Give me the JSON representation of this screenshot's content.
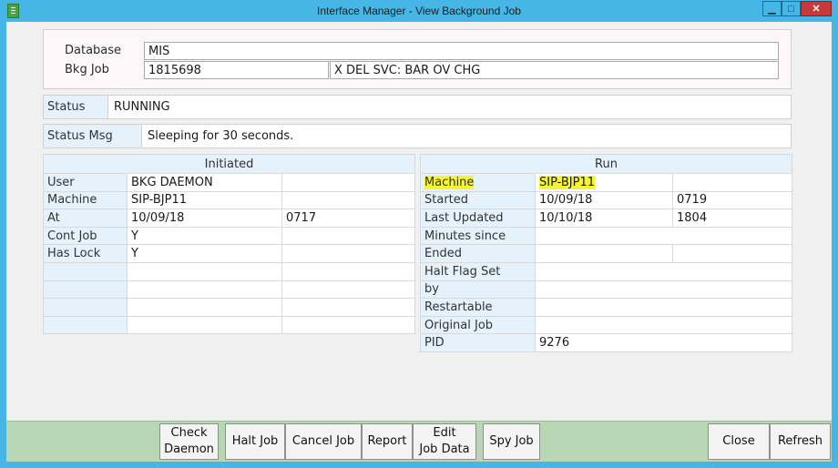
{
  "window": {
    "title": "Interface Manager - View Background Job",
    "min_label": "▁",
    "max_label": "□",
    "close_label": "✕"
  },
  "header": {
    "database_label": "Database",
    "database_value": "MIS",
    "bkg_job_label": "Bkg Job",
    "bkg_job_id": "1815698",
    "bkg_job_desc": "X DEL SVC: BAR OV CHG"
  },
  "status": {
    "label": "Status",
    "value": "RUNNING"
  },
  "status_msg": {
    "label": "Status Msg",
    "value": "Sleeping for 30 seconds."
  },
  "initiated": {
    "title": "Initiated",
    "rows": [
      {
        "label": "User",
        "value": "BKG DAEMON",
        "extra": ""
      },
      {
        "label": "Machine",
        "value": "SIP-BJP11",
        "extra": ""
      },
      {
        "label": "At",
        "value": "10/09/18",
        "extra": "0717"
      },
      {
        "label": "Cont Job",
        "value": "Y",
        "extra": ""
      },
      {
        "label": "Has Lock",
        "value": "Y",
        "extra": ""
      },
      {
        "label": "",
        "value": "",
        "extra": ""
      },
      {
        "label": "",
        "value": "",
        "extra": ""
      },
      {
        "label": "",
        "value": "",
        "extra": ""
      },
      {
        "label": "",
        "value": "",
        "extra": ""
      }
    ]
  },
  "run": {
    "title": "Run",
    "rows": [
      {
        "label": "Machine",
        "value": "SIP-BJP11",
        "extra": ""
      },
      {
        "label": "Started",
        "value": "10/09/18",
        "extra": "0719"
      },
      {
        "label": "Last Updated",
        "value": "10/10/18",
        "extra": "1804"
      },
      {
        "label": "Minutes since",
        "value": "",
        "extra": ""
      },
      {
        "label": "Ended",
        "value": "",
        "extra": ""
      },
      {
        "label": "Halt Flag Set",
        "value": "",
        "extra": ""
      },
      {
        "label": "by",
        "value": "",
        "extra": ""
      },
      {
        "label": "Restartable",
        "value": "",
        "extra": ""
      },
      {
        "label": "Original Job",
        "value": "",
        "extra": ""
      },
      {
        "label": "PID",
        "value": "9276",
        "extra": ""
      }
    ]
  },
  "footer": {
    "check_daemon_line1": "Check",
    "check_daemon_line2": "Daemon",
    "halt_job": "Halt Job",
    "cancel_job": "Cancel Job",
    "report": "Report",
    "edit_job_data_line1": "Edit",
    "edit_job_data_line2": "Job Data",
    "spy_job": "Spy Job",
    "close": "Close",
    "refresh": "Refresh"
  },
  "colors": {
    "highlight": "#f5f530",
    "title_bar": "#45b6e6",
    "footer": "#b8d7b4"
  }
}
